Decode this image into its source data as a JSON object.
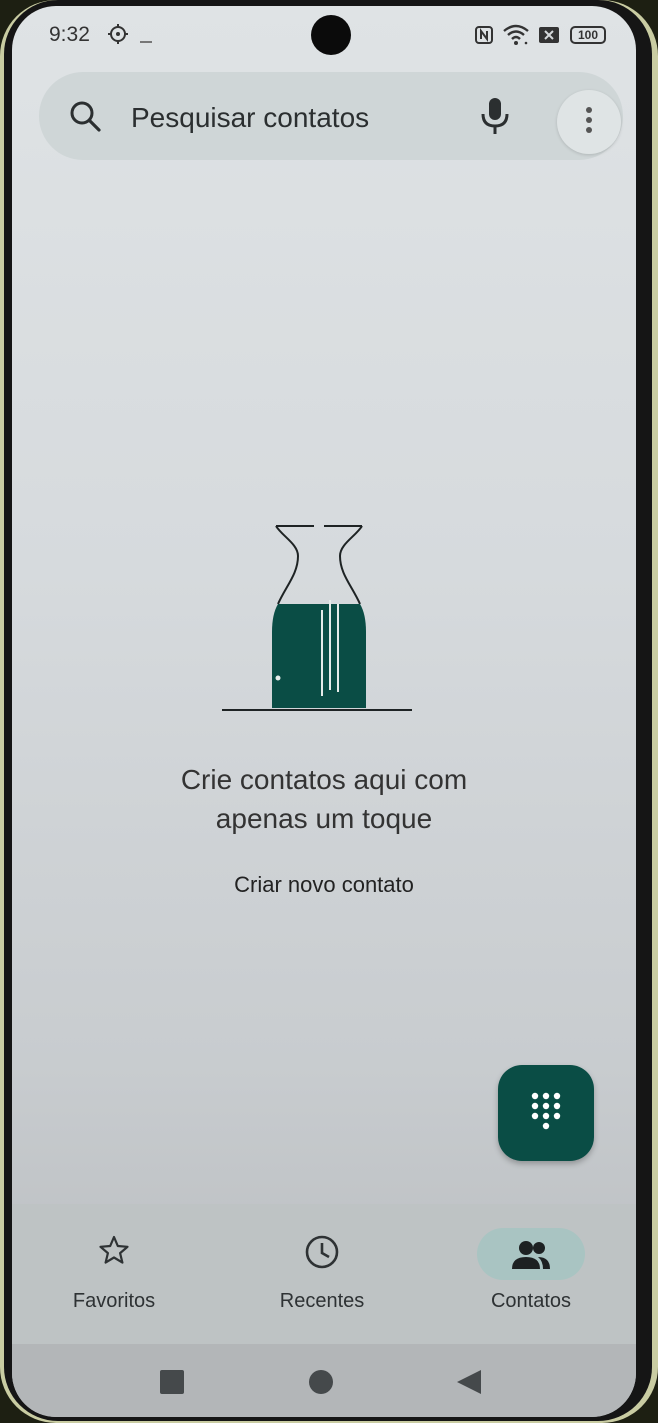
{
  "status_bar": {
    "time": "9:32",
    "battery": "100",
    "icons": [
      "nfc-icon",
      "wifi-icon",
      "sim-icon",
      "battery-icon"
    ]
  },
  "search": {
    "placeholder": "Pesquisar contatos"
  },
  "empty_state": {
    "title_line1": "Crie contatos aqui com",
    "title_line2": "apenas um toque",
    "action_label": "Criar novo contato"
  },
  "bottom_nav": {
    "items": [
      {
        "label": "Favoritos",
        "icon": "star-icon",
        "active": false
      },
      {
        "label": "Recentes",
        "icon": "clock-icon",
        "active": false
      },
      {
        "label": "Contatos",
        "icon": "people-icon",
        "active": true
      }
    ]
  },
  "colors": {
    "accent": "#0a4d45",
    "active_pill": "#a9c4c2"
  }
}
